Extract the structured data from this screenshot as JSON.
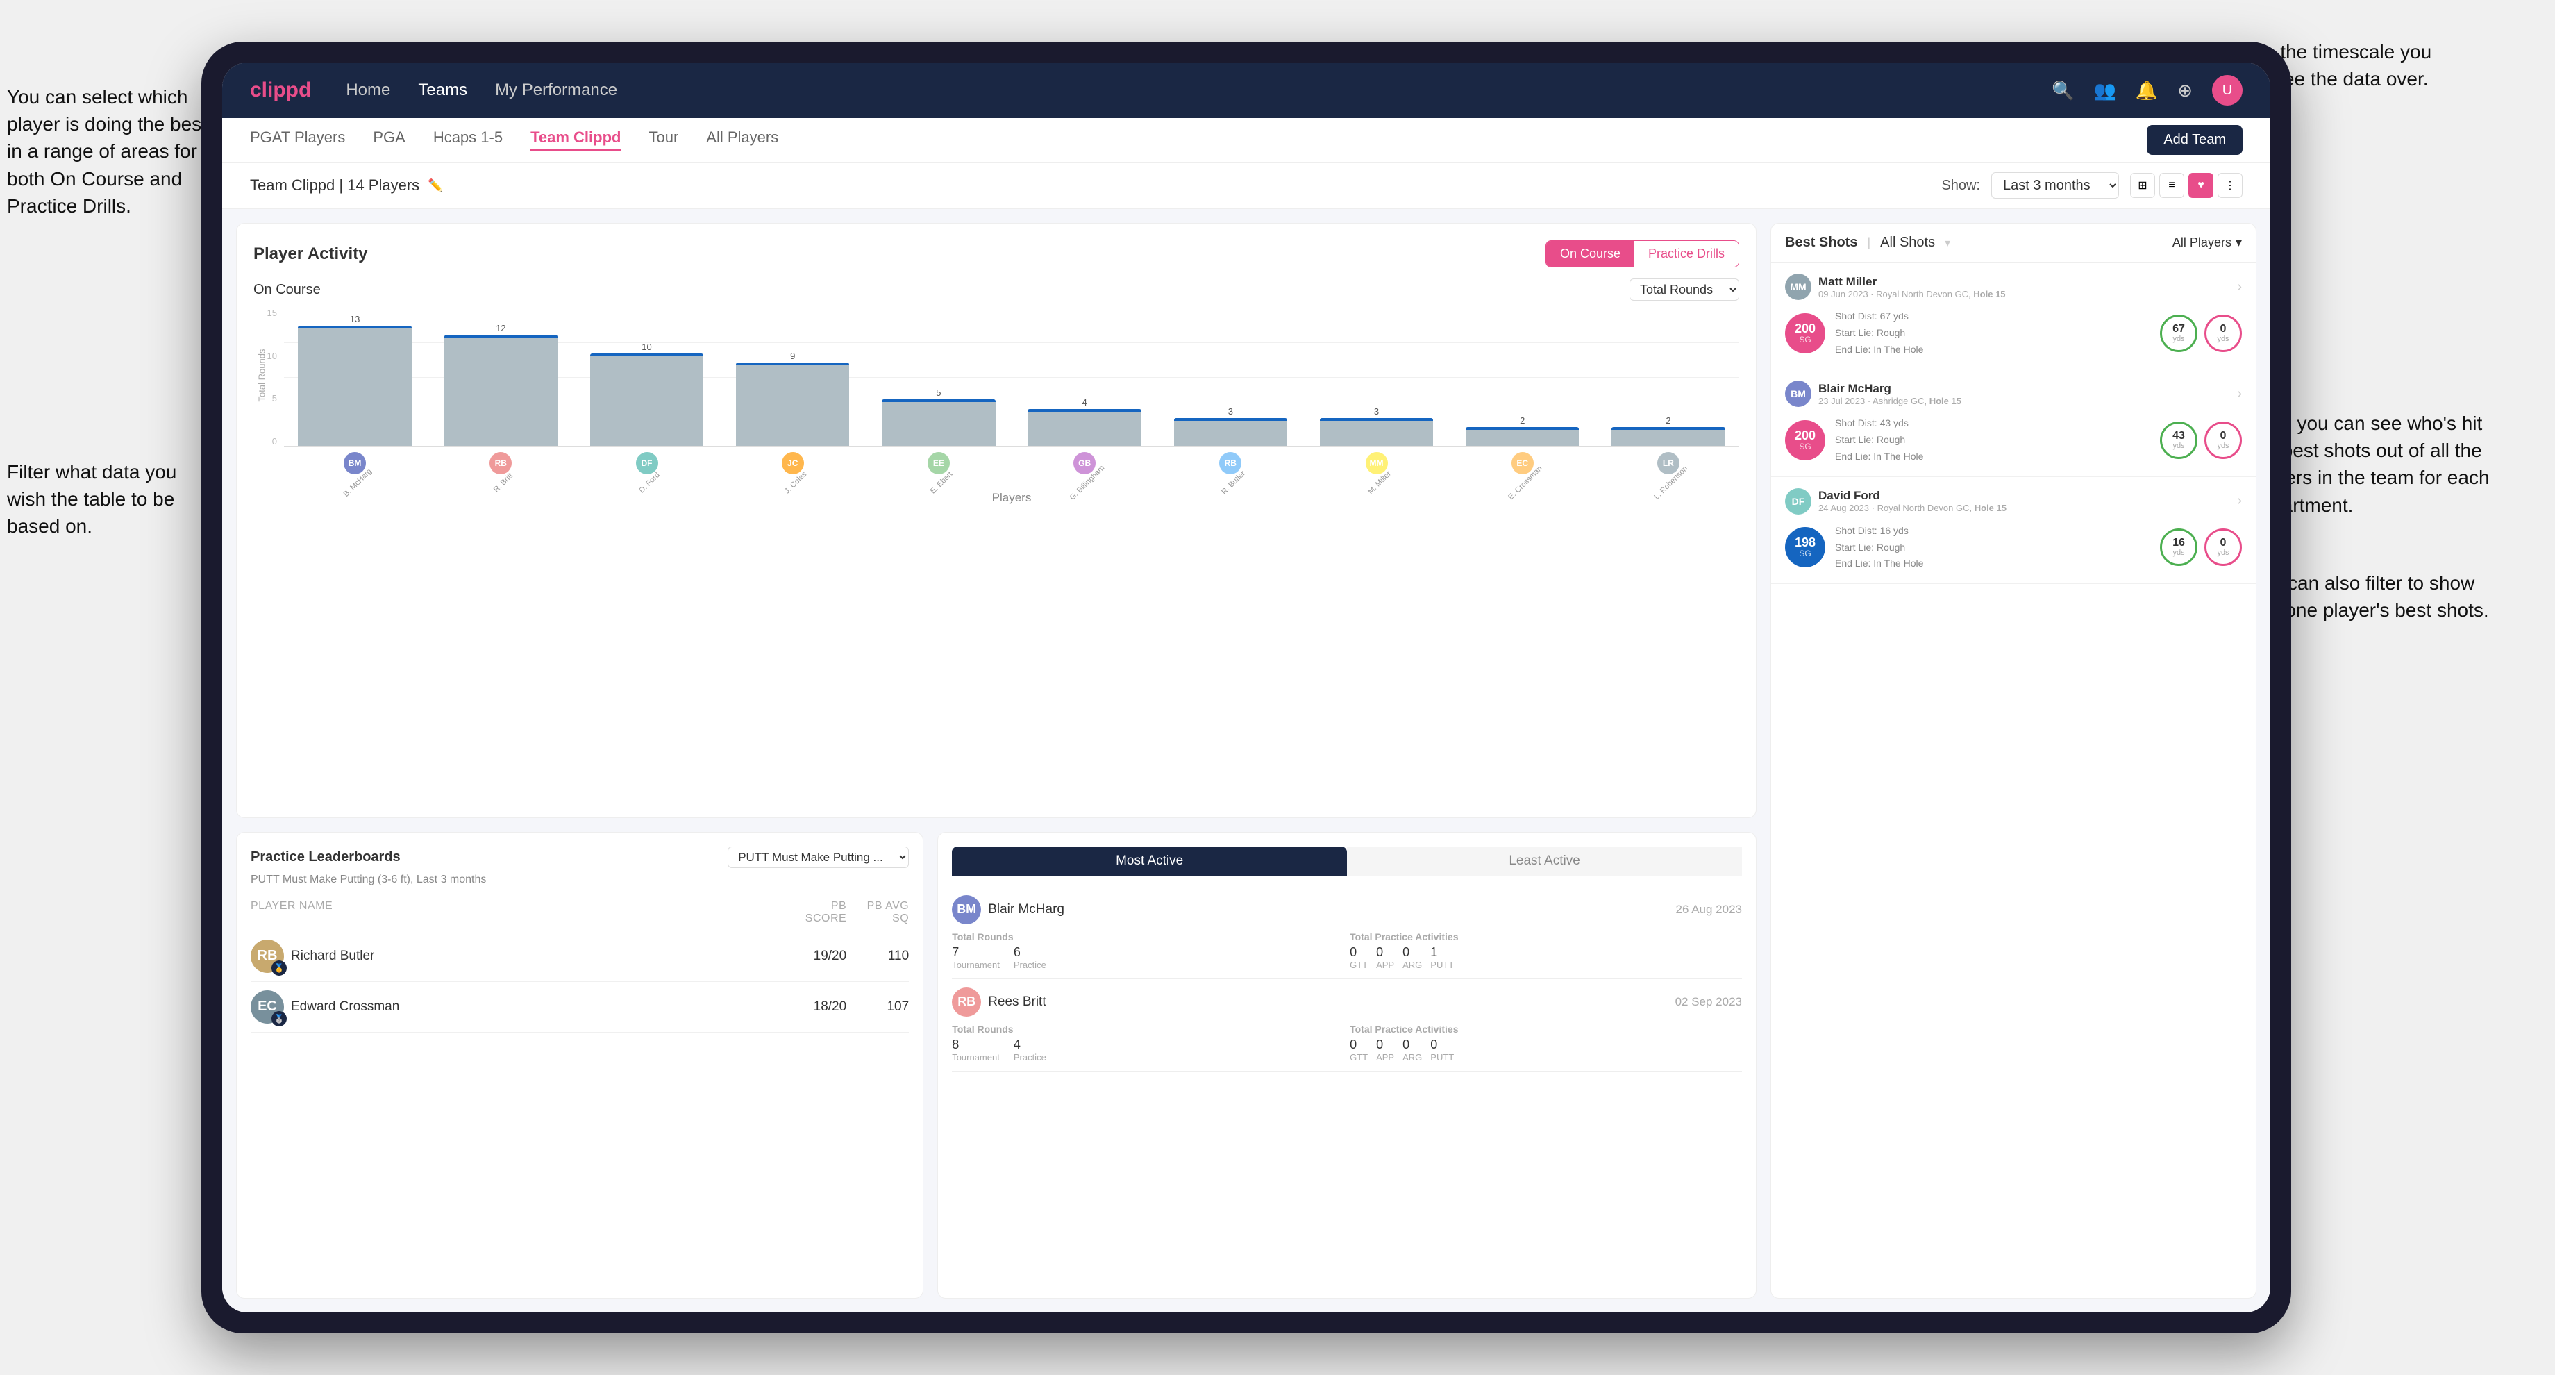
{
  "annotations": {
    "top_right": "Choose the timescale you wish to see the data over.",
    "left_top": "You can select which player is doing the best in a range of areas for both On Course and Practice Drills.",
    "left_mid": "Filter what data you wish the table to be based on.",
    "right_mid": "Here you can see who's hit the best shots out of all the players in the team for each department.",
    "right_bottom": "You can also filter to show just one player's best shots."
  },
  "navbar": {
    "logo": "clippd",
    "links": [
      "Home",
      "Teams",
      "My Performance"
    ],
    "active_link": "Teams"
  },
  "subnav": {
    "tabs": [
      "PGAT Players",
      "PGA",
      "Hcaps 1-5",
      "Team Clippd",
      "Tour",
      "All Players"
    ],
    "active_tab": "Team Clippd",
    "add_button": "Add Team"
  },
  "team_header": {
    "name": "Team Clippd | 14 Players",
    "show_label": "Show:",
    "timescale": "Last 3 months",
    "views": [
      "grid",
      "list",
      "heart",
      "settings"
    ]
  },
  "player_activity": {
    "title": "Player Activity",
    "toggle_on_course": "On Course",
    "toggle_practice": "Practice Drills",
    "chart_section": "On Course",
    "chart_filter": "Total Rounds",
    "y_axis_label": "Total Rounds",
    "x_axis_label": "Players",
    "bars": [
      {
        "name": "B. McHarg",
        "value": 13,
        "initials": "BM"
      },
      {
        "name": "R. Britt",
        "value": 12,
        "initials": "RB"
      },
      {
        "name": "D. Ford",
        "value": 10,
        "initials": "DF"
      },
      {
        "name": "J. Coles",
        "value": 9,
        "initials": "JC"
      },
      {
        "name": "E. Ebert",
        "value": 5,
        "initials": "EE"
      },
      {
        "name": "G. Billingham",
        "value": 4,
        "initials": "GB"
      },
      {
        "name": "R. Butler",
        "value": 3,
        "initials": "RB"
      },
      {
        "name": "M. Miller",
        "value": 3,
        "initials": "MM"
      },
      {
        "name": "E. Crossman",
        "value": 2,
        "initials": "EC"
      },
      {
        "name": "L. Robertson",
        "value": 2,
        "initials": "LR"
      }
    ]
  },
  "best_shots": {
    "title": "Best Shots",
    "tab_best": "Best Shots",
    "tab_all": "All Shots",
    "filter_label": "All Players",
    "players": [
      {
        "name": "Matt Miller",
        "date": "09 Jun 2023",
        "course": "Royal North Devon GC",
        "hole": "Hole 15",
        "badge": "200",
        "badge_sub": "SG",
        "badge_color": "pink",
        "shot_dist": "67 yds",
        "start_lie": "Rough",
        "end_lie": "In The Hole",
        "metric1_val": "67",
        "metric1_unit": "yds",
        "metric1_color": "green",
        "metric2_val": "0",
        "metric2_unit": "yds",
        "metric2_color": "pink",
        "initials": "MM"
      },
      {
        "name": "Blair McHarg",
        "date": "23 Jul 2023",
        "course": "Ashridge GC",
        "hole": "Hole 15",
        "badge": "200",
        "badge_sub": "SG",
        "badge_color": "pink",
        "shot_dist": "43 yds",
        "start_lie": "Rough",
        "end_lie": "In The Hole",
        "metric1_val": "43",
        "metric1_unit": "yds",
        "metric1_color": "green",
        "metric2_val": "0",
        "metric2_unit": "yds",
        "metric2_color": "pink",
        "initials": "BM"
      },
      {
        "name": "David Ford",
        "date": "24 Aug 2023",
        "course": "Royal North Devon GC",
        "hole": "Hole 15",
        "badge": "198",
        "badge_sub": "SG",
        "badge_color": "blue",
        "shot_dist": "16 yds",
        "start_lie": "Rough",
        "end_lie": "In The Hole",
        "metric1_val": "16",
        "metric1_unit": "yds",
        "metric1_color": "green",
        "metric2_val": "0",
        "metric2_unit": "yds",
        "metric2_color": "pink",
        "initials": "DF"
      }
    ]
  },
  "practice_leaderboards": {
    "title": "Practice Leaderboards",
    "filter": "PUTT Must Make Putting ...",
    "subtitle": "PUTT Must Make Putting (3-6 ft), Last 3 months",
    "col_name": "PLAYER NAME",
    "col_pb": "PB SCORE",
    "col_avg": "PB AVG SQ",
    "players": [
      {
        "name": "Richard Butler",
        "rank": "1",
        "pb_score": "19/20",
        "pb_avg": "110",
        "initials": "RB",
        "bg": "#c8a96e",
        "rank_emoji": "🥇"
      },
      {
        "name": "Edward Crossman",
        "rank": "2",
        "pb_score": "18/20",
        "pb_avg": "107",
        "initials": "EC",
        "bg": "#78909c",
        "rank_emoji": "🥈"
      }
    ]
  },
  "most_active": {
    "tab_most": "Most Active",
    "tab_least": "Least Active",
    "players": [
      {
        "name": "Blair McHarg",
        "date": "26 Aug 2023",
        "total_rounds_label": "Total Rounds",
        "tournament": "7",
        "practice": "6",
        "total_practice_label": "Total Practice Activities",
        "gtt": "0",
        "app": "0",
        "arg": "0",
        "putt": "1",
        "initials": "BM",
        "bg": "#7986cb"
      },
      {
        "name": "Rees Britt",
        "date": "02 Sep 2023",
        "total_rounds_label": "Total Rounds",
        "tournament": "8",
        "practice": "4",
        "total_practice_label": "Total Practice Activities",
        "gtt": "0",
        "app": "0",
        "arg": "0",
        "putt": "0",
        "initials": "RB",
        "bg": "#ef9a9a"
      }
    ]
  },
  "colors": {
    "brand_pink": "#e84d8a",
    "brand_navy": "#1a2744",
    "accent_green": "#4caf50",
    "text_primary": "#333",
    "text_secondary": "#888"
  }
}
